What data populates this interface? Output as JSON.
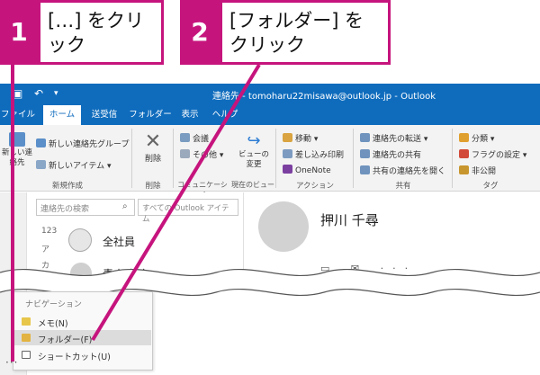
{
  "window": {
    "title": "連絡先 - tomoharu22misawa@outlook.jp - Outlook"
  },
  "tabs": [
    {
      "label": "ファイル",
      "active": false
    },
    {
      "label": "ホーム",
      "active": true
    },
    {
      "label": "送受信",
      "active": false
    },
    {
      "label": "フォルダー",
      "active": false
    },
    {
      "label": "表示",
      "active": false
    },
    {
      "label": "ヘルプ",
      "active": false
    }
  ],
  "ribbon": {
    "new_contact_short": "新しい連絡先",
    "new_group": "新しい連絡先グループ",
    "new_item": "新しいアイテム",
    "delete": "削除",
    "meeting": "会議",
    "other": "その他",
    "change_view": "ビューの変更",
    "move": "移動",
    "mail_merge": "差し込み印刷",
    "onenote": "OneNote",
    "forward_contact": "連絡先の転送",
    "share_contacts": "連絡先の共有",
    "open_shared": "共有の連絡先を開く",
    "categorize": "分類",
    "follow_up": "フラグの設定",
    "private": "非公開",
    "groups": {
      "new": "新規作成",
      "delete": "削除",
      "communication": "コミュニケーション",
      "current_view": "現在のビュー",
      "actions": "アクション",
      "share": "共有",
      "tags": "タグ"
    }
  },
  "contacts_pane": {
    "search_placeholder": "連絡先の検索",
    "scope": "すべての Outlook アイテム",
    "index_123": "123",
    "index_a": "ア",
    "index_ka": "カ",
    "contacts": [
      "全社員",
      "青山 英次"
    ]
  },
  "detail": {
    "name": "押川 千尋",
    "actions": "▭ ✉ ···"
  },
  "navigation_menu": {
    "title": "ナビゲーション",
    "items": [
      {
        "label": "メモ(N)",
        "highlighted": false
      },
      {
        "label": "フォルダー(F)",
        "highlighted": true
      },
      {
        "label": "ショートカット(U)",
        "highlighted": false
      }
    ],
    "more": "···"
  },
  "callouts": [
    {
      "number": "1",
      "line1": "[…] をクリ",
      "line2": "ック"
    },
    {
      "number": "2",
      "line1": "[フォルダー] を",
      "line2": "クリック"
    }
  ],
  "colors": {
    "accent": "#c6147d",
    "outlook_blue": "#0f6cbd"
  }
}
